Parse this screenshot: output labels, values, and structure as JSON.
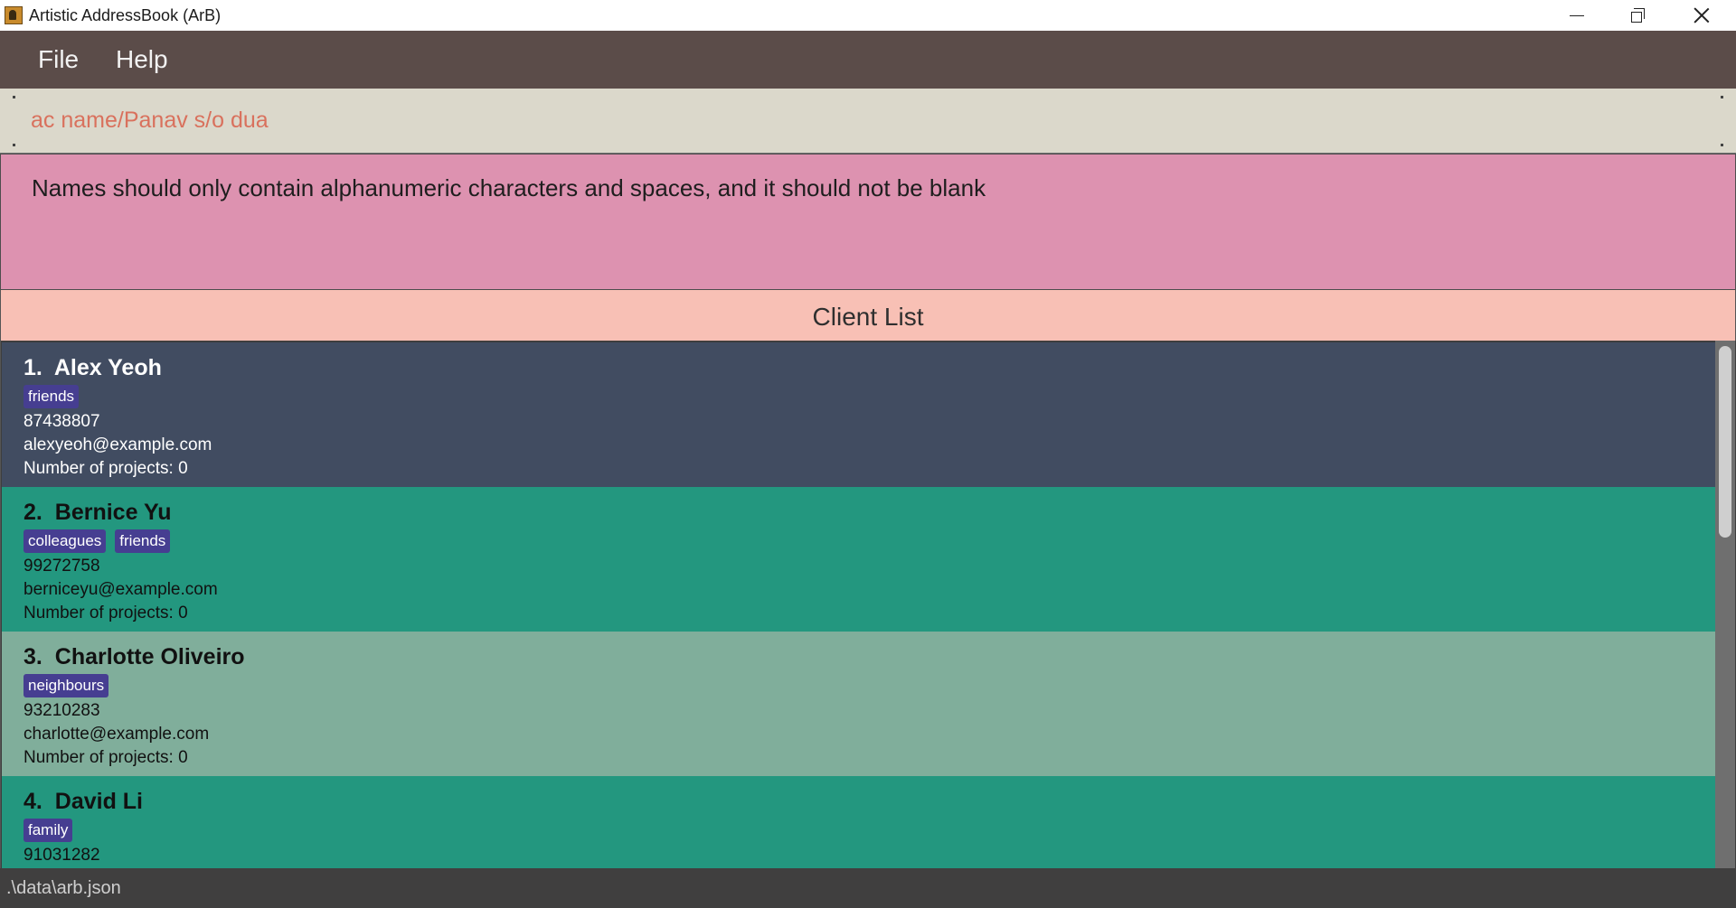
{
  "window": {
    "title": "Artistic AddressBook (ArB)",
    "app_icon": "arb-app-icon",
    "controls": {
      "minimize": "minimize-icon",
      "maximize": "restore-icon",
      "close": "close-icon"
    }
  },
  "menu": {
    "items": [
      {
        "label": "File"
      },
      {
        "label": "Help"
      }
    ]
  },
  "command_box": {
    "value": "ac name/Panav s/o dua",
    "text_color": "#d9715d"
  },
  "result_display": {
    "message": "Names should only contain alphanumeric characters and spaces, and it should not be blank",
    "background": "#dd92b0"
  },
  "client_list": {
    "title": "Client List",
    "clients": [
      {
        "index": "1.",
        "name": "Alex Yeoh",
        "tags": [
          "friends"
        ],
        "phone": "87438807",
        "email": "alexyeoh@example.com",
        "projects": "Number of projects: 0",
        "background": "#414c61"
      },
      {
        "index": "2.",
        "name": "Bernice Yu",
        "tags": [
          "colleagues",
          "friends"
        ],
        "phone": "99272758",
        "email": "berniceyu@example.com",
        "projects": "Number of projects: 0",
        "background": "#23977f"
      },
      {
        "index": "3.",
        "name": "Charlotte Oliveiro",
        "tags": [
          "neighbours"
        ],
        "phone": "93210283",
        "email": "charlotte@example.com",
        "projects": "Number of projects: 0",
        "background": "#80ae9b"
      },
      {
        "index": "4.",
        "name": "David Li",
        "tags": [
          "family"
        ],
        "phone": "91031282",
        "email": "",
        "projects": "",
        "background": "#23977f"
      }
    ]
  },
  "status_bar": {
    "path": ".\\data\\arb.json"
  },
  "colors": {
    "menubar": "#5b4c49",
    "command_box": "#dbd8cb",
    "list_header": "#f8c0b5",
    "tag": "#463e91",
    "statusbar": "#403f3f"
  }
}
